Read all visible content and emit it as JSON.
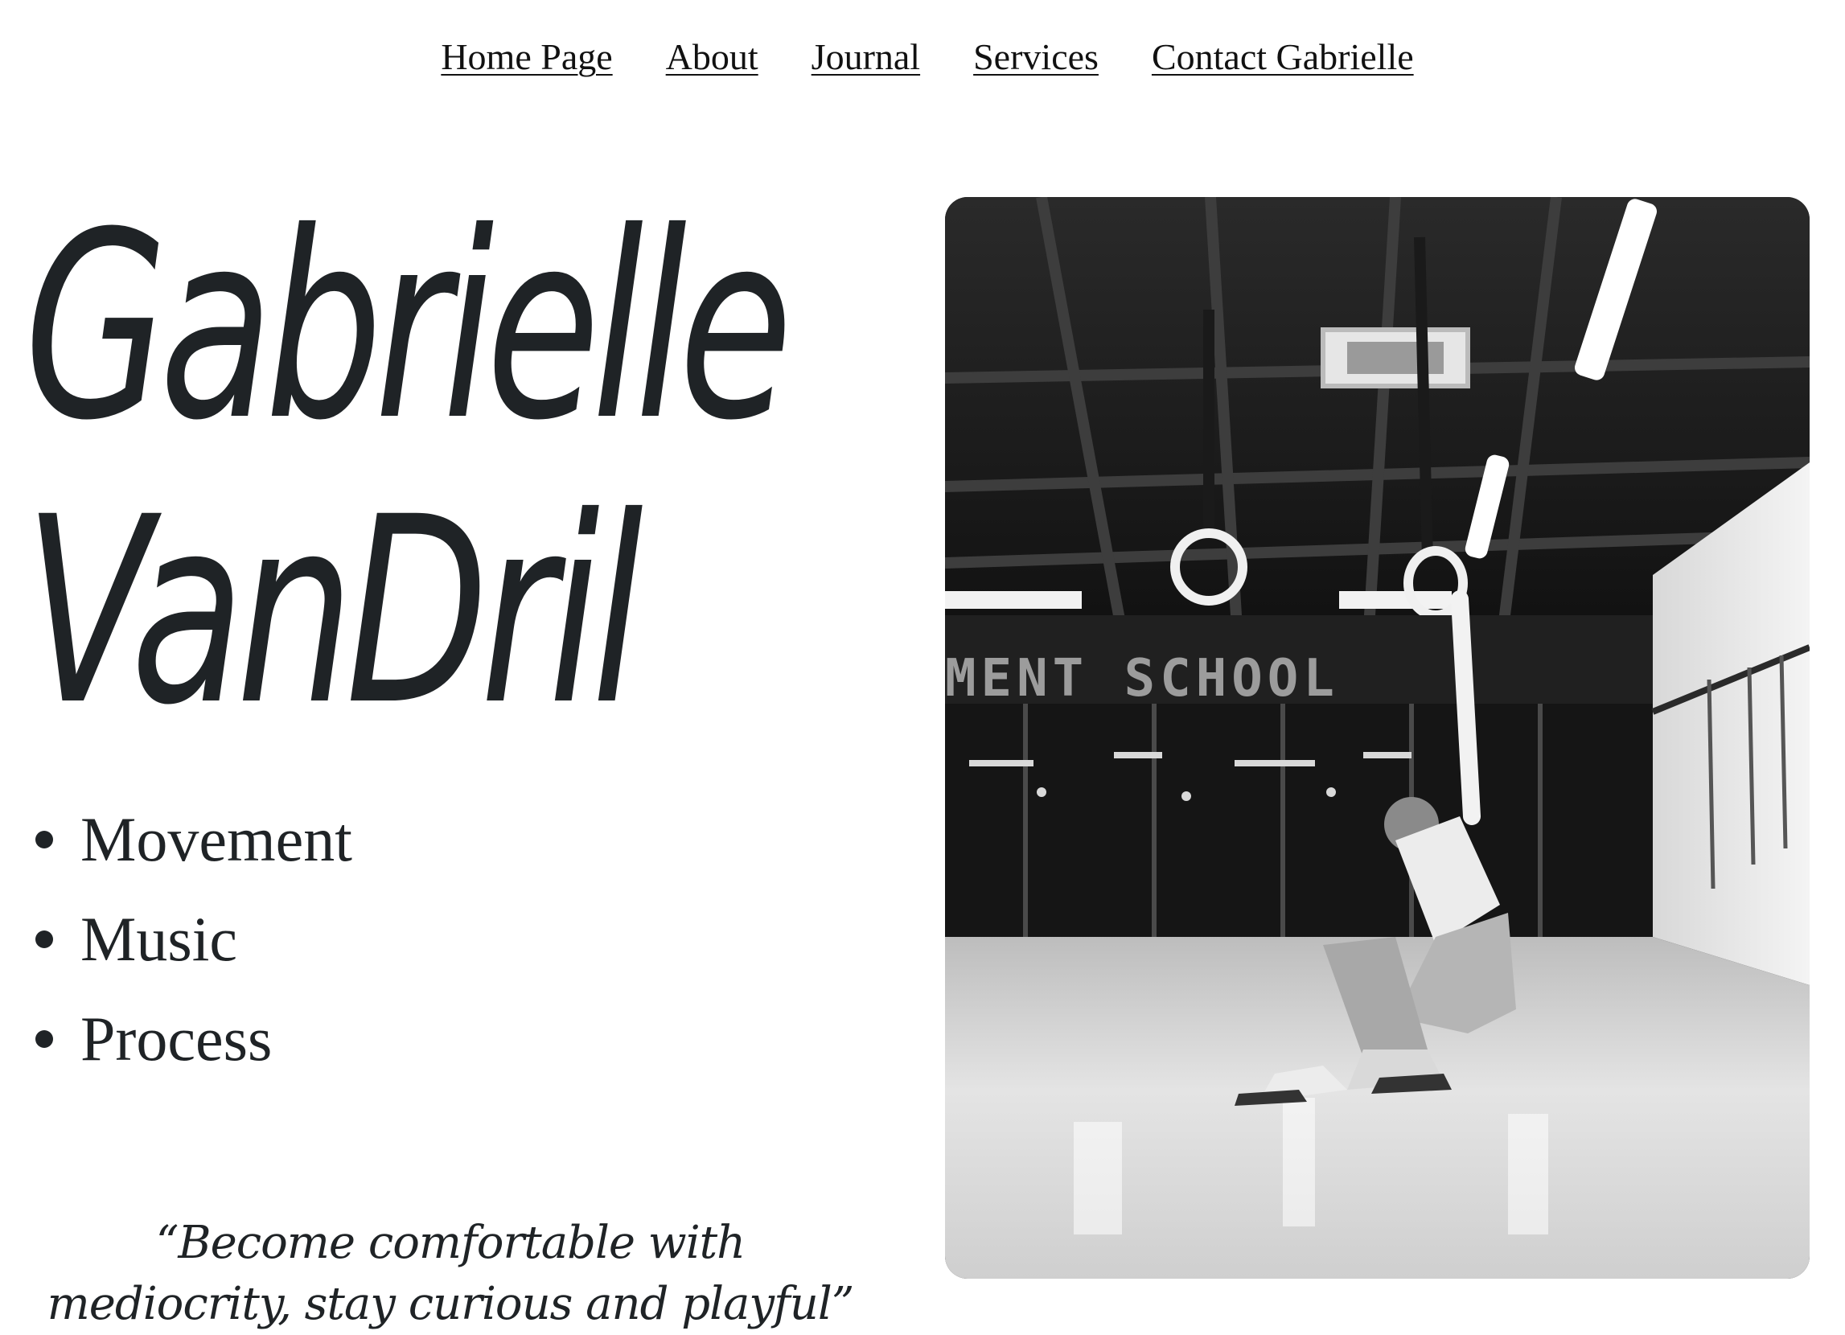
{
  "nav": {
    "items": [
      {
        "label": "Home Page"
      },
      {
        "label": "About"
      },
      {
        "label": "Journal"
      },
      {
        "label": "Services"
      },
      {
        "label": "Contact Gabrielle"
      }
    ]
  },
  "hero": {
    "name_line1": "Gabrielle",
    "name_line2": "VanDril",
    "pillars": [
      "Movement",
      "Music",
      "Process"
    ],
    "quote": "“Become comfortable with mediocrity, stay curious and playful”"
  },
  "photo": {
    "wall_sign": "MENT SCHOOL",
    "style": "black-and-white"
  }
}
